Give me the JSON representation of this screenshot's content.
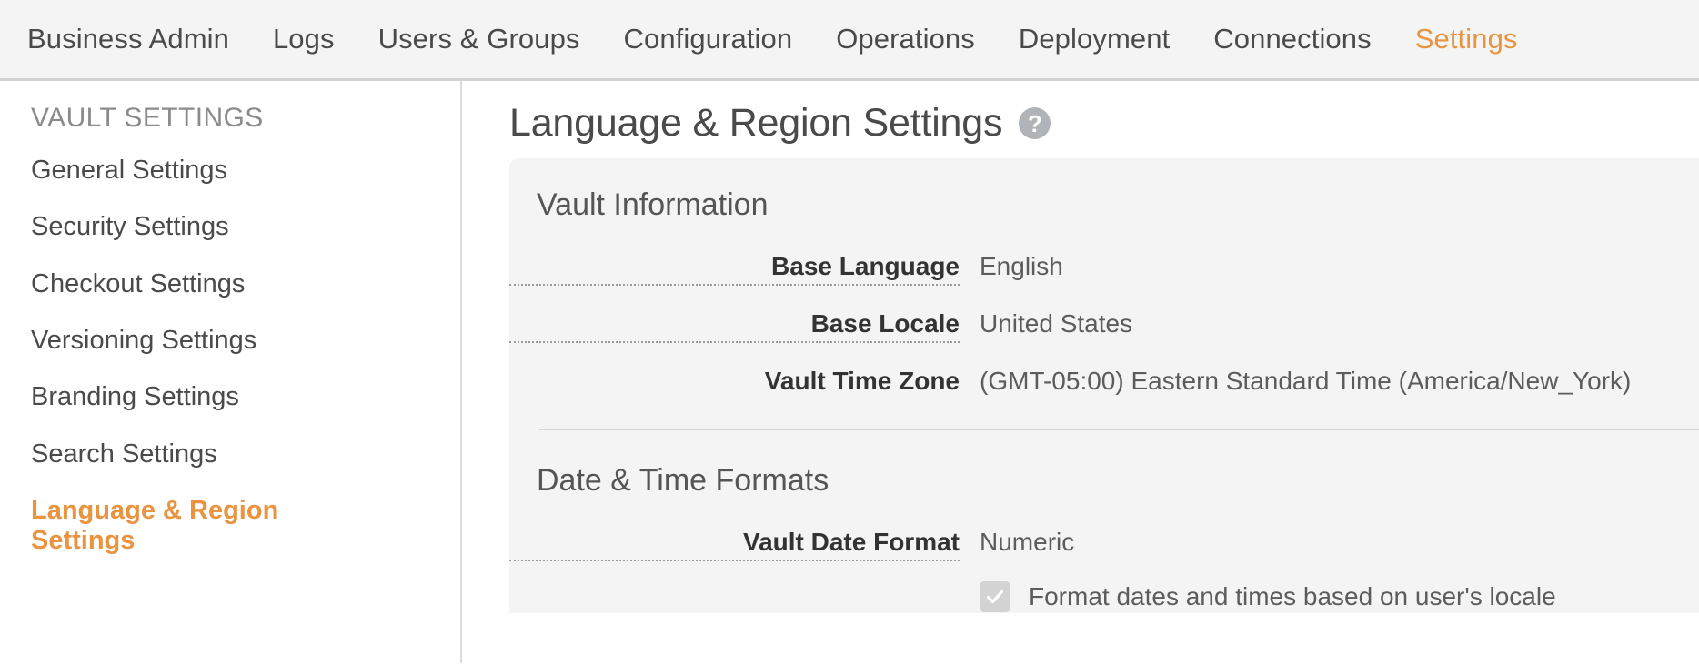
{
  "topnav": {
    "items": [
      {
        "label": "Business Admin",
        "active": false
      },
      {
        "label": "Logs",
        "active": false
      },
      {
        "label": "Users & Groups",
        "active": false
      },
      {
        "label": "Configuration",
        "active": false
      },
      {
        "label": "Operations",
        "active": false
      },
      {
        "label": "Deployment",
        "active": false
      },
      {
        "label": "Connections",
        "active": false
      },
      {
        "label": "Settings",
        "active": true
      }
    ],
    "accent_color": "#e89440"
  },
  "sidebar": {
    "title": "VAULT SETTINGS",
    "items": [
      {
        "label": "General Settings",
        "active": false
      },
      {
        "label": "Security Settings",
        "active": false
      },
      {
        "label": "Checkout Settings",
        "active": false
      },
      {
        "label": "Versioning Settings",
        "active": false
      },
      {
        "label": "Branding Settings",
        "active": false
      },
      {
        "label": "Search Settings",
        "active": false
      },
      {
        "label": "Language & Region Settings",
        "active": true
      }
    ]
  },
  "main": {
    "page_title": "Language & Region Settings",
    "help_icon": "help-circle-icon",
    "help_glyph": "?",
    "sections": [
      {
        "heading": "Vault Information",
        "fields": [
          {
            "label": "Base Language",
            "value": "English",
            "dotted": true
          },
          {
            "label": "Base Locale",
            "value": "United States",
            "dotted": true
          },
          {
            "label": "Vault Time Zone",
            "value": "(GMT-05:00) Eastern Standard Time (America/New_York)",
            "dotted": false
          }
        ]
      },
      {
        "heading": "Date & Time Formats",
        "fields": [
          {
            "label": "Vault Date Format",
            "value": "Numeric",
            "dotted": true
          }
        ],
        "checkbox": {
          "label": "Format dates and times based on user's locale",
          "checked": true,
          "disabled": true
        }
      }
    ]
  }
}
